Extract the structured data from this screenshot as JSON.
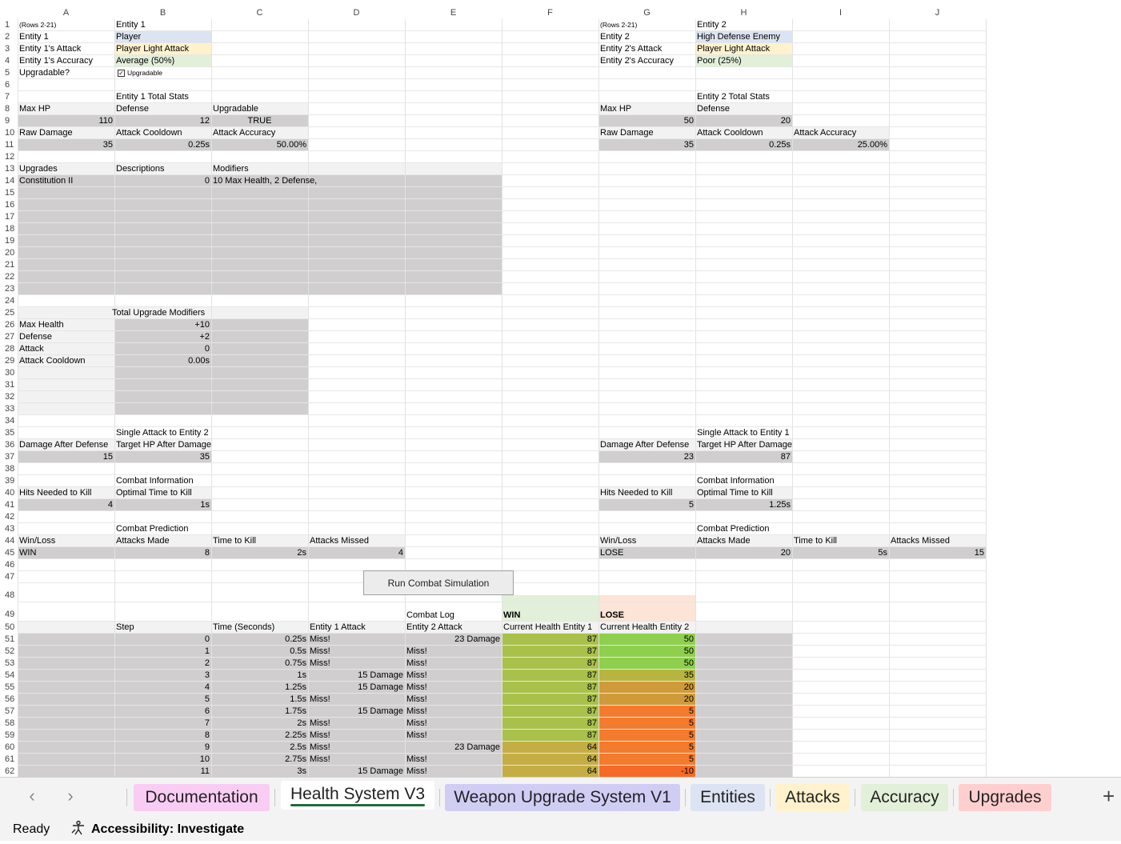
{
  "colors": {
    "entity_blue": "#dce3f2",
    "attack_yellow": "#fff2cc",
    "accuracy_green": "#e2efd9",
    "gray_fill": "#d0cece",
    "light_gray": "#f2f2f2",
    "win_header": "#e2efd9",
    "lose_header": "#fce4d6",
    "tab_documentation": "#f9cdf3",
    "tab_weapon": "#d0cdf5",
    "tab_entities": "#dce3f2",
    "tab_attacks": "#fff2cc",
    "tab_accuracy": "#e2efd9",
    "tab_upgrades": "#ffcfcf"
  },
  "column_headers": [
    "A",
    "B",
    "C",
    "D",
    "E",
    "F",
    "G",
    "H",
    "I",
    "J"
  ],
  "cells": {
    "A1": "(Rows 2-21)",
    "B1": "Entity 1",
    "A2": "Entity 1",
    "B2": "Player",
    "A3": "Entity 1's Attack",
    "B3": "Player Light Attack",
    "A4": "Entity 1's Accuracy",
    "B4": "Average (50%)",
    "A5": "Upgradable?",
    "B5": "Upgradable",
    "B7": "Entity 1 Total Stats",
    "A8": "Max HP",
    "B8": "Defense",
    "C8": "Upgradable",
    "A9": "110",
    "B9": "12",
    "C9": "TRUE",
    "A10": "Raw Damage",
    "B10": "Attack Cooldown",
    "C10": "Attack Accuracy",
    "A11": "35",
    "B11": "0.25s",
    "C11": "50.00%",
    "A13": "Upgrades",
    "B13": "Descriptions",
    "C13": "Modifiers",
    "A14": "Constitution II",
    "B14": "0",
    "C14": "10 Max Health, 2 Defense,",
    "B25": "Total Upgrade Modifiers",
    "A26": "Max Health",
    "B26": "+10",
    "A27": "Defense",
    "B27": "+2",
    "A28": "Attack",
    "B28": "0",
    "A29": "Attack Cooldown",
    "B29": "0.00s",
    "B35": "Single Attack to Entity 2",
    "A36": "Damage After Defense",
    "B36": "Target HP After Damage",
    "A37": "15",
    "B37": "35",
    "B39": "Combat Information",
    "A40": "Hits Needed to Kill",
    "B40": "Optimal Time to Kill",
    "A41": "4",
    "B41": "1s",
    "B43": "Combat Prediction",
    "A44": "Win/Loss",
    "B44": "Attacks Made",
    "C44": "Time to Kill",
    "D44": "Attacks Missed",
    "A45": "WIN",
    "B45": "8",
    "C45": "2s",
    "D45": "4",
    "G1": "(Rows 2-21)",
    "H1": "Entity 2",
    "G2": "Entity 2",
    "H2": "High Defense Enemy",
    "G3": "Entity 2's Attack",
    "H3": "Player Light Attack",
    "G4": "Entity 2's Accuracy",
    "H4": "Poor (25%)",
    "H7": "Entity 2 Total Stats",
    "G8": "Max HP",
    "H8": "Defense",
    "G9": "50",
    "H9": "20",
    "G10": "Raw Damage",
    "H10": "Attack Cooldown",
    "I10": "Attack Accuracy",
    "G11": "35",
    "H11": "0.25s",
    "I11": "25.00%",
    "H35": "Single Attack to Entity 1",
    "G36": "Damage After Defense",
    "H36": "Target HP After Damage",
    "G37": "23",
    "H37": "87",
    "H39": "Combat Information",
    "G40": "Hits Needed to Kill",
    "H40": "Optimal Time to Kill",
    "G41": "5",
    "H41": "1.25s",
    "H43": "Combat Prediction",
    "G44": "Win/Loss",
    "H44": "Attacks Made",
    "I44": "Time to Kill",
    "J44": "Attacks Missed",
    "G45": "LOSE",
    "H45": "20",
    "I45": "5s",
    "J45": "15",
    "E49": "Combat Log",
    "F49": "WIN",
    "G49": "LOSE",
    "B50": "Step",
    "C50": "Time (Seconds)",
    "D50": "Entity 1 Attack",
    "E50": "Entity 2 Attack",
    "F50": "Current Health Entity 1",
    "G50": "Current Health Entity 2"
  },
  "run_button_label": "Run Combat Simulation",
  "combat_log": [
    {
      "step": "0",
      "time": "0.25s",
      "e1": "Miss!",
      "e1dmg": "",
      "e2": "",
      "e2dmg": "23 Damage",
      "h1": "87",
      "h2": "50",
      "c1": "#a9c14b",
      "c2": "#8fcf4e"
    },
    {
      "step": "1",
      "time": "0.5s",
      "e1": "Miss!",
      "e1dmg": "",
      "e2": "Miss!",
      "e2dmg": "",
      "h1": "87",
      "h2": "50",
      "c1": "#a9c14b",
      "c2": "#8fcf4e"
    },
    {
      "step": "2",
      "time": "0.75s",
      "e1": "Miss!",
      "e1dmg": "",
      "e2": "Miss!",
      "e2dmg": "",
      "h1": "87",
      "h2": "50",
      "c1": "#a9c14b",
      "c2": "#8fcf4e"
    },
    {
      "step": "3",
      "time": "1s",
      "e1": "",
      "e1dmg": "15 Damage",
      "e2": "Miss!",
      "e2dmg": "",
      "h1": "87",
      "h2": "35",
      "c1": "#a9c14b",
      "c2": "#b7b540"
    },
    {
      "step": "4",
      "time": "1.25s",
      "e1": "",
      "e1dmg": "15 Damage",
      "e2": "Miss!",
      "e2dmg": "",
      "h1": "87",
      "h2": "20",
      "c1": "#a9c14b",
      "c2": "#cf9b3a"
    },
    {
      "step": "5",
      "time": "1.5s",
      "e1": "Miss!",
      "e1dmg": "",
      "e2": "Miss!",
      "e2dmg": "",
      "h1": "87",
      "h2": "20",
      "c1": "#a9c14b",
      "c2": "#cf9b3a"
    },
    {
      "step": "6",
      "time": "1.75s",
      "e1": "",
      "e1dmg": "15 Damage",
      "e2": "Miss!",
      "e2dmg": "",
      "h1": "87",
      "h2": "5",
      "c1": "#a9c14b",
      "c2": "#f47b2e"
    },
    {
      "step": "7",
      "time": "2s",
      "e1": "Miss!",
      "e1dmg": "",
      "e2": "Miss!",
      "e2dmg": "",
      "h1": "87",
      "h2": "5",
      "c1": "#a9c14b",
      "c2": "#f47b2e"
    },
    {
      "step": "8",
      "time": "2.25s",
      "e1": "Miss!",
      "e1dmg": "",
      "e2": "Miss!",
      "e2dmg": "",
      "h1": "87",
      "h2": "5",
      "c1": "#a9c14b",
      "c2": "#f47b2e"
    },
    {
      "step": "9",
      "time": "2.5s",
      "e1": "Miss!",
      "e1dmg": "",
      "e2": "",
      "e2dmg": "23 Damage",
      "h1": "64",
      "h2": "5",
      "c1": "#c4ad44",
      "c2": "#f47b2e"
    },
    {
      "step": "10",
      "time": "2.75s",
      "e1": "Miss!",
      "e1dmg": "",
      "e2": "Miss!",
      "e2dmg": "",
      "h1": "64",
      "h2": "5",
      "c1": "#c4ad44",
      "c2": "#f47b2e"
    },
    {
      "step": "11",
      "time": "3s",
      "e1": "",
      "e1dmg": "15 Damage",
      "e2": "Miss!",
      "e2dmg": "",
      "h1": "64",
      "h2": "-10",
      "c1": "#c4ad44",
      "c2": "#f56a26"
    }
  ],
  "tabs": [
    {
      "label": "Documentation",
      "color": "#f9cdf3"
    },
    {
      "label": "Health System V3",
      "color": "#ffffff",
      "active": true
    },
    {
      "label": "Weapon Upgrade System V1",
      "color": "#d0cdf5"
    },
    {
      "label": "Entities",
      "color": "#dce3f2"
    },
    {
      "label": "Attacks",
      "color": "#fff2cc"
    },
    {
      "label": "Accuracy",
      "color": "#e2efd9"
    },
    {
      "label": "Upgrades",
      "color": "#ffcfcf"
    }
  ],
  "icons": {
    "prev": "chevron-left-icon",
    "next": "chevron-right-icon",
    "add": "plus-icon",
    "accessibility": "accessibility-icon"
  },
  "status": {
    "ready": "Ready",
    "accessibility": "Accessibility: Investigate"
  }
}
